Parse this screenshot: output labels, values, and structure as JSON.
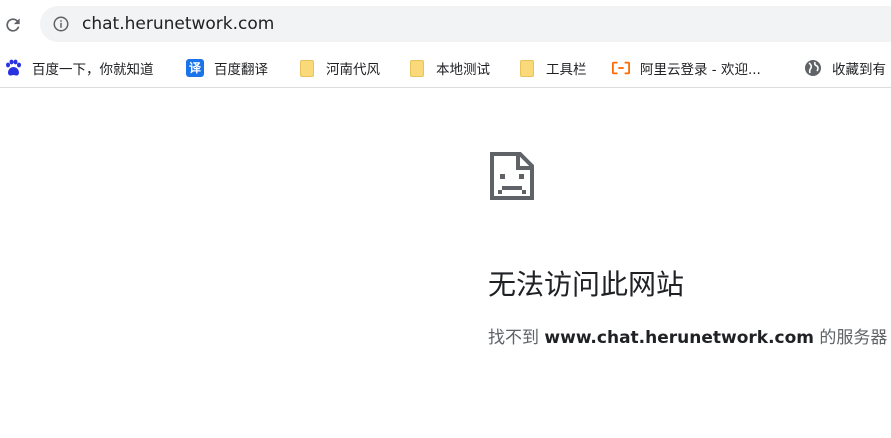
{
  "toolbar": {
    "reload_icon": "reload-icon",
    "info_icon": "info-icon"
  },
  "omnibox": {
    "url": "chat.herunetwork.com"
  },
  "bookmarks": [
    {
      "icon": "baidu-paw-icon",
      "label": "百度一下，你就知道"
    },
    {
      "icon": "translate-icon",
      "label": "百度翻译",
      "glyph": "译"
    },
    {
      "icon": "folder-icon",
      "label": "河南代风"
    },
    {
      "icon": "folder-icon",
      "label": "本地测试"
    },
    {
      "icon": "folder-icon",
      "label": "工具栏"
    },
    {
      "icon": "aliyun-icon",
      "label": "阿里云登录 - 欢迎..."
    },
    {
      "icon": "globe-icon",
      "label": "收藏到有"
    }
  ],
  "error_page": {
    "icon": "sad-page-icon",
    "title": "无法访问此网站",
    "desc_prefix": "找不到 ",
    "desc_domain": "www.chat.herunetwork.com",
    "desc_suffix": " 的服务器 I"
  },
  "colors": {
    "omnibox_bg": "#f1f3f4",
    "baidu_blue": "#2932e1",
    "aliyun_orange": "#ff6a00",
    "folder_yellow": "#f9d97a",
    "error_icon": "#5f6368"
  }
}
